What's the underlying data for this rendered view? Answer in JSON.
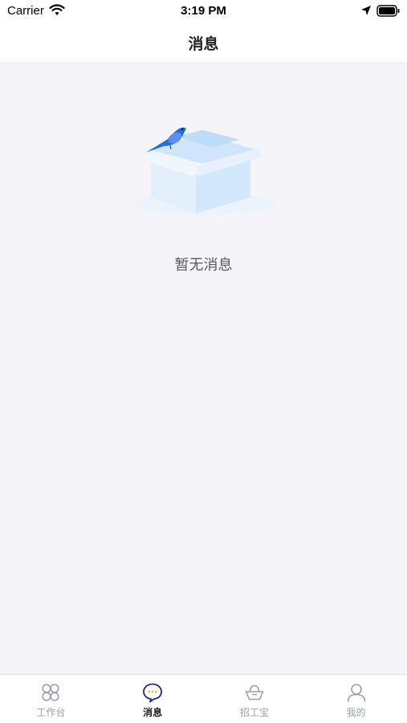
{
  "status_bar": {
    "carrier": "Carrier",
    "time": "3:19 PM"
  },
  "nav": {
    "title": "消息"
  },
  "empty_state": {
    "text": "暂无消息"
  },
  "tabs": [
    {
      "label": "工作台",
      "icon": "grid-icon",
      "active": false
    },
    {
      "label": "消息",
      "icon": "chat-bubble-icon",
      "active": true
    },
    {
      "label": "招工宝",
      "icon": "ingot-icon",
      "active": false
    },
    {
      "label": "我的",
      "icon": "user-icon",
      "active": false
    }
  ],
  "colors": {
    "accent": "#1f2a8a",
    "tab_inactive": "#9aa0ab",
    "background": "#f4f4f9"
  }
}
